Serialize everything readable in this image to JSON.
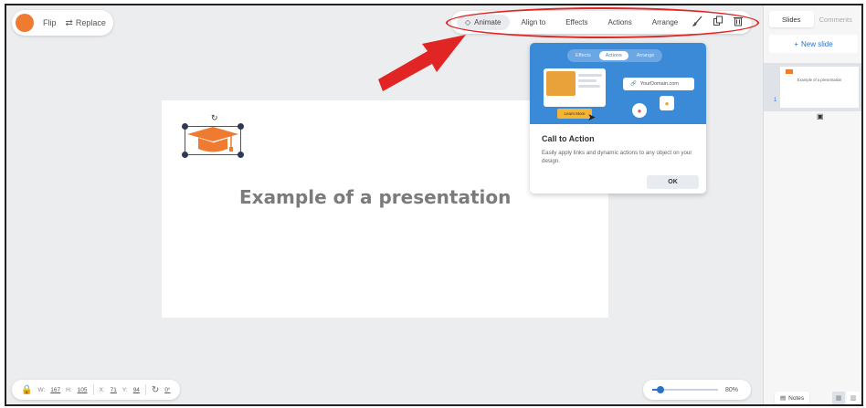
{
  "toolbar_left": {
    "flip_label": "Flip",
    "replace_label": "Replace",
    "color": "#ee7b30"
  },
  "toolbar": {
    "animate_label": "Animate",
    "align_label": "Align to",
    "effects_label": "Effects",
    "actions_label": "Actions",
    "arrange_label": "Arrange",
    "icons": [
      "brush-icon",
      "copy-icon",
      "trash-icon"
    ]
  },
  "slide": {
    "title": "Example of a presentation"
  },
  "popover": {
    "tabs": [
      "Effects",
      "Actions",
      "Arrange"
    ],
    "active_tab": "Actions",
    "domain": "YourDomain.com",
    "learn_more": "Learn More",
    "title": "Call to Action",
    "description": "Easily apply links and dynamic actions to any object on your design.",
    "ok_label": "OK"
  },
  "bottom_bar": {
    "w_label": "W:",
    "w_value": "167",
    "h_label": "H:",
    "h_value": "105",
    "x_label": "X:",
    "x_value": "71",
    "y_label": "Y:",
    "y_value": "94",
    "rotation_value": "0°"
  },
  "zoom": {
    "level": "80%",
    "fraction": 0.12
  },
  "panel": {
    "tab_slides": "Slides",
    "tab_comments": "Comments",
    "new_slide": "New slide",
    "thumb_number": "1",
    "thumb_caption": "Example of a presentation",
    "notes_label": "Notes"
  },
  "annotation_color": "#e12424"
}
